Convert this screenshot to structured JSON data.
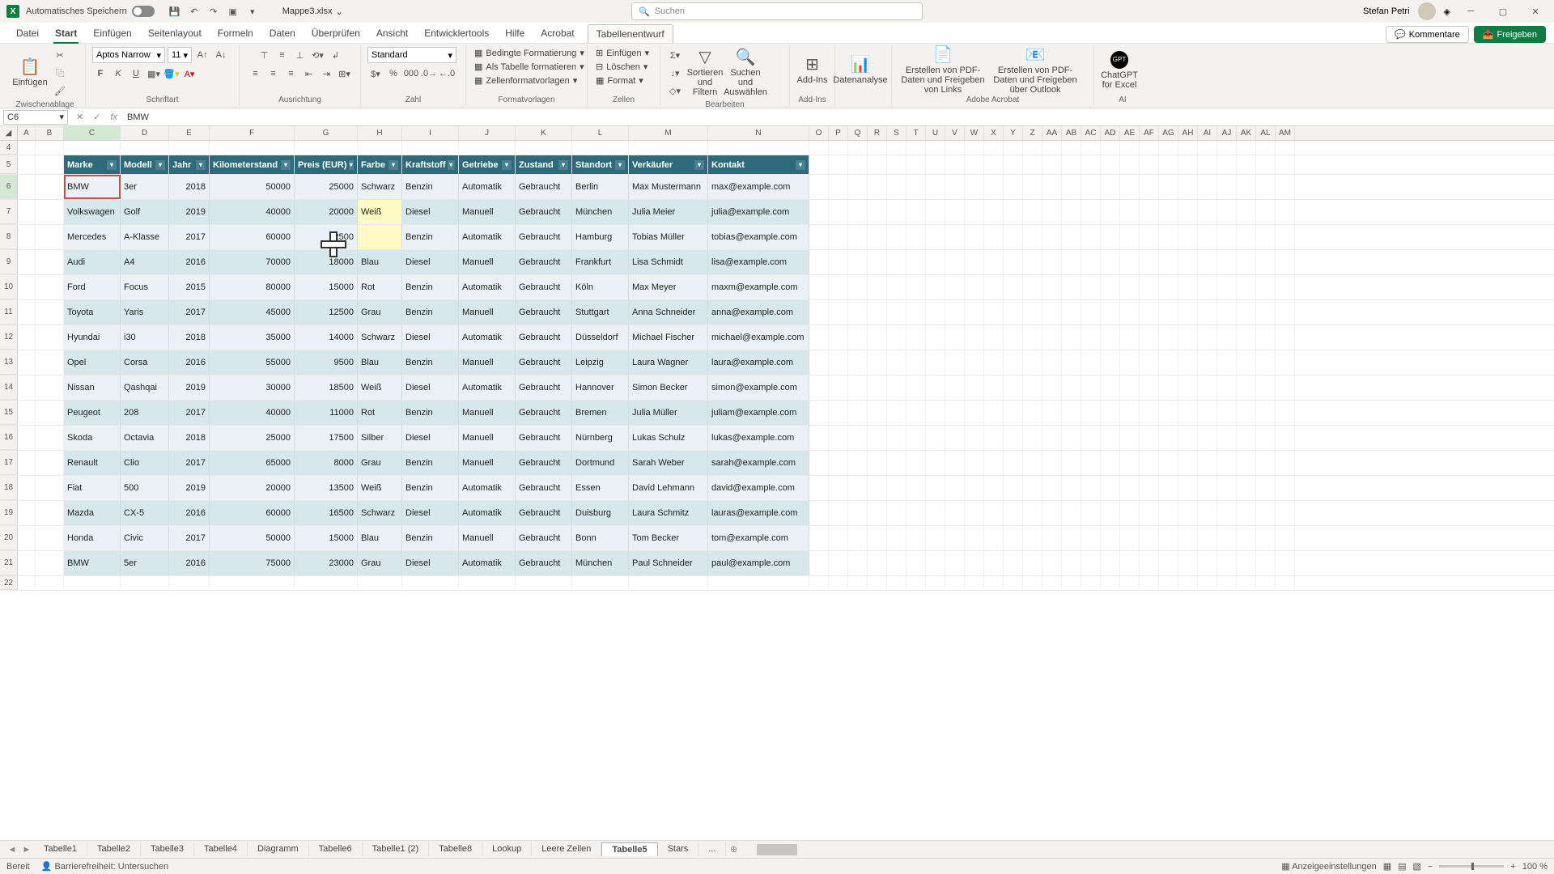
{
  "title": {
    "autosave": "Automatisches Speichern",
    "filename": "Mappe3.xlsx",
    "search_placeholder": "Suchen",
    "user": "Stefan Petri"
  },
  "menu": {
    "tabs": [
      "Datei",
      "Start",
      "Einfügen",
      "Seitenlayout",
      "Formeln",
      "Daten",
      "Überprüfen",
      "Ansicht",
      "Entwicklertools",
      "Hilfe",
      "Acrobat",
      "Tabellenentwurf"
    ],
    "active": "Start",
    "comments": "Kommentare",
    "share": "Freigeben"
  },
  "ribbon": {
    "clipboard": {
      "paste": "Einfügen",
      "label": "Zwischenablage"
    },
    "font": {
      "name": "Aptos Narrow",
      "size": "11",
      "label": "Schriftart"
    },
    "align": {
      "label": "Ausrichtung"
    },
    "number": {
      "format": "Standard",
      "label": "Zahl"
    },
    "styles": {
      "cond": "Bedingte Formatierung",
      "astable": "Als Tabelle formatieren",
      "cellstyle": "Zellenformatvorlagen",
      "label": "Formatvorlagen"
    },
    "cells": {
      "insert": "Einfügen",
      "delete": "Löschen",
      "format": "Format",
      "label": "Zellen"
    },
    "editing": {
      "sort": "Sortieren und Filtern",
      "find": "Suchen und Auswählen",
      "label": "Bearbeiten"
    },
    "addins": {
      "btn": "Add-Ins",
      "label": "Add-Ins"
    },
    "data": {
      "btn": "Datenanalyse"
    },
    "acrobat": {
      "btn1": "Erstellen von PDF-Daten und Freigeben von Links",
      "btn2": "Erstellen von PDF-Daten und Freigeben über Outlook",
      "label": "Adobe Acrobat"
    },
    "ai": {
      "btn": "ChatGPT for Excel",
      "label": "AI"
    }
  },
  "fbar": {
    "name": "C6",
    "formula": "BMW"
  },
  "columns": [
    "A",
    "B",
    "C",
    "D",
    "E",
    "F",
    "G",
    "H",
    "I",
    "J",
    "K",
    "L",
    "M",
    "N",
    "O",
    "P",
    "Q",
    "R",
    "S",
    "T",
    "U",
    "V",
    "W",
    "X",
    "Y",
    "Z",
    "AA",
    "AB",
    "AC",
    "AD",
    "AE",
    "AF",
    "AG",
    "AH",
    "AI",
    "AJ",
    "AK",
    "AL",
    "AM"
  ],
  "rows_top": [
    4
  ],
  "table": {
    "headers": [
      "Marke",
      "Modell",
      "Jahr",
      "Kilometerstand",
      "Preis (EUR)",
      "Farbe",
      "Kraftstoff",
      "Getriebe",
      "Zustand",
      "Standort",
      "Verkäufer",
      "Kontakt"
    ],
    "rows": [
      [
        "BMW",
        "3er",
        "2018",
        "50000",
        "25000",
        "Schwarz",
        "Benzin",
        "Automatik",
        "Gebraucht",
        "Berlin",
        "Max Mustermann",
        "max@example.com"
      ],
      [
        "Volkswagen",
        "Golf",
        "2019",
        "40000",
        "20000",
        "Weiß",
        "Diesel",
        "Manuell",
        "Gebraucht",
        "München",
        "Julia Meier",
        "julia@example.com"
      ],
      [
        "Mercedes",
        "A-Klasse",
        "2017",
        "60000",
        "22500",
        "",
        "Benzin",
        "Automatik",
        "Gebraucht",
        "Hamburg",
        "Tobias Müller",
        "tobias@example.com"
      ],
      [
        "Audi",
        "A4",
        "2016",
        "70000",
        "18000",
        "Blau",
        "Diesel",
        "Manuell",
        "Gebraucht",
        "Frankfurt",
        "Lisa Schmidt",
        "lisa@example.com"
      ],
      [
        "Ford",
        "Focus",
        "2015",
        "80000",
        "15000",
        "Rot",
        "Benzin",
        "Automatik",
        "Gebraucht",
        "Köln",
        "Max Meyer",
        "maxm@example.com"
      ],
      [
        "Toyota",
        "Yaris",
        "2017",
        "45000",
        "12500",
        "Grau",
        "Benzin",
        "Manuell",
        "Gebraucht",
        "Stuttgart",
        "Anna Schneider",
        "anna@example.com"
      ],
      [
        "Hyundai",
        "i30",
        "2018",
        "35000",
        "14000",
        "Schwarz",
        "Diesel",
        "Automatik",
        "Gebraucht",
        "Düsseldorf",
        "Michael Fischer",
        "michael@example.com"
      ],
      [
        "Opel",
        "Corsa",
        "2016",
        "55000",
        "9500",
        "Blau",
        "Benzin",
        "Manuell",
        "Gebraucht",
        "Leipzig",
        "Laura Wagner",
        "laura@example.com"
      ],
      [
        "Nissan",
        "Qashqai",
        "2019",
        "30000",
        "18500",
        "Weiß",
        "Diesel",
        "Automatik",
        "Gebraucht",
        "Hannover",
        "Simon Becker",
        "simon@example.com"
      ],
      [
        "Peugeot",
        "208",
        "2017",
        "40000",
        "11000",
        "Rot",
        "Benzin",
        "Manuell",
        "Gebraucht",
        "Bremen",
        "Julia Müller",
        "juliam@example.com"
      ],
      [
        "Skoda",
        "Octavia",
        "2018",
        "25000",
        "17500",
        "Silber",
        "Diesel",
        "Manuell",
        "Gebraucht",
        "Nürnberg",
        "Lukas Schulz",
        "lukas@example.com"
      ],
      [
        "Renault",
        "Clio",
        "2017",
        "65000",
        "8000",
        "Grau",
        "Benzin",
        "Manuell",
        "Gebraucht",
        "Dortmund",
        "Sarah Weber",
        "sarah@example.com"
      ],
      [
        "Fiat",
        "500",
        "2019",
        "20000",
        "13500",
        "Weiß",
        "Benzin",
        "Automatik",
        "Gebraucht",
        "Essen",
        "David Lehmann",
        "david@example.com"
      ],
      [
        "Mazda",
        "CX-5",
        "2016",
        "60000",
        "16500",
        "Schwarz",
        "Diesel",
        "Automatik",
        "Gebraucht",
        "Duisburg",
        "Laura Schmitz",
        "lauras@example.com"
      ],
      [
        "Honda",
        "Civic",
        "2017",
        "50000",
        "15000",
        "Blau",
        "Benzin",
        "Manuell",
        "Gebraucht",
        "Bonn",
        "Tom Becker",
        "tom@example.com"
      ],
      [
        "BMW",
        "5er",
        "2016",
        "75000",
        "23000",
        "Grau",
        "Diesel",
        "Automatik",
        "Gebraucht",
        "München",
        "Paul Schneider",
        "paul@example.com"
      ]
    ]
  },
  "sheets": {
    "tabs": [
      "Tabelle1",
      "Tabelle2",
      "Tabelle3",
      "Tabelle4",
      "Diagramm",
      "Tabelle6",
      "Tabelle1 (2)",
      "Tabelle8",
      "Lookup",
      "Leere Zeilen",
      "Tabelle5",
      "Stars",
      "..."
    ],
    "active": "Tabelle5"
  },
  "status": {
    "ready": "Bereit",
    "access": "Barrierefreiheit: Untersuchen",
    "display": "Anzeigeeinstellungen",
    "zoom": "100 %"
  }
}
